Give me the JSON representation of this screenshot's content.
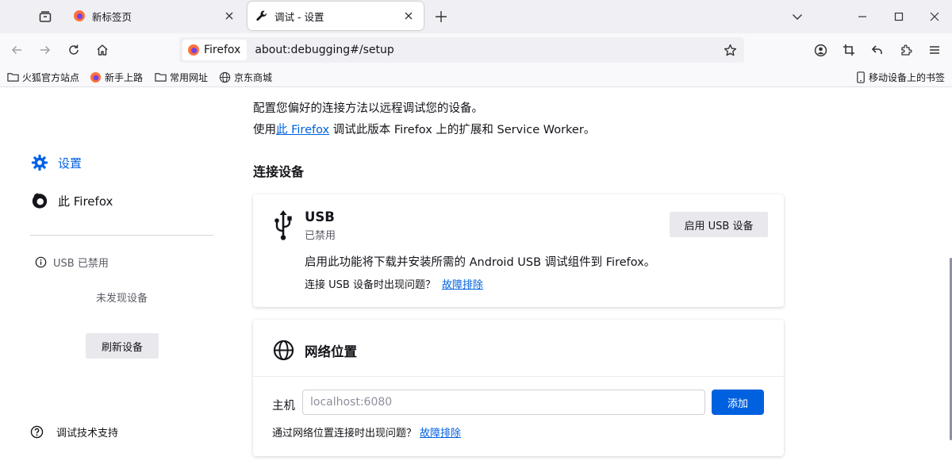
{
  "tabs": [
    {
      "title": "新标签页",
      "active": false
    },
    {
      "title": "调试 - 设置",
      "active": true
    }
  ],
  "navbar": {
    "identity_label": "Firefox",
    "url": "about:debugging#/setup"
  },
  "bookmarks": [
    {
      "label": "火狐官方站点",
      "icon": "folder-icon"
    },
    {
      "label": "新手上路",
      "icon": "firefox-icon"
    },
    {
      "label": "常用网址",
      "icon": "folder-icon"
    },
    {
      "label": "京东商城",
      "icon": "globe-icon"
    }
  ],
  "mobile_bookmarks": "移动设备上的书签",
  "sidebar": {
    "setup_label": "设置",
    "this_firefox_label": "此 Firefox",
    "usb_status": "USB 已禁用",
    "no_devices": "未发现设备",
    "refresh_button": "刷新设备",
    "support_label": "调试技术支持"
  },
  "main": {
    "intro_line1": "配置您偏好的连接方法以远程调试您的设备。",
    "intro_line2_prefix": "使用",
    "intro_line2_link": "此 Firefox",
    "intro_line2_suffix": " 调试此版本 Firefox 上的扩展和 Service Worker。",
    "section_title": "连接设备",
    "usb": {
      "title": "USB",
      "status": "已禁用",
      "enable_button": "启用 USB 设备",
      "description": "启用此功能将下载并安装所需的 Android USB 调试组件到 Firefox。",
      "trouble_text": "连接 USB 设备时出现问题？",
      "trouble_link": "故障排除"
    },
    "network": {
      "title": "网络位置",
      "host_label": "主机",
      "host_value": "",
      "host_placeholder": "localhost:6080",
      "add_button": "添加",
      "trouble_text": "通过网络位置连接时出现问题？",
      "trouble_link": "故障排除"
    }
  },
  "colors": {
    "accent": "#0061e0",
    "firefox_orange": "#ff7139",
    "firefox_purple": "#7542e5"
  }
}
